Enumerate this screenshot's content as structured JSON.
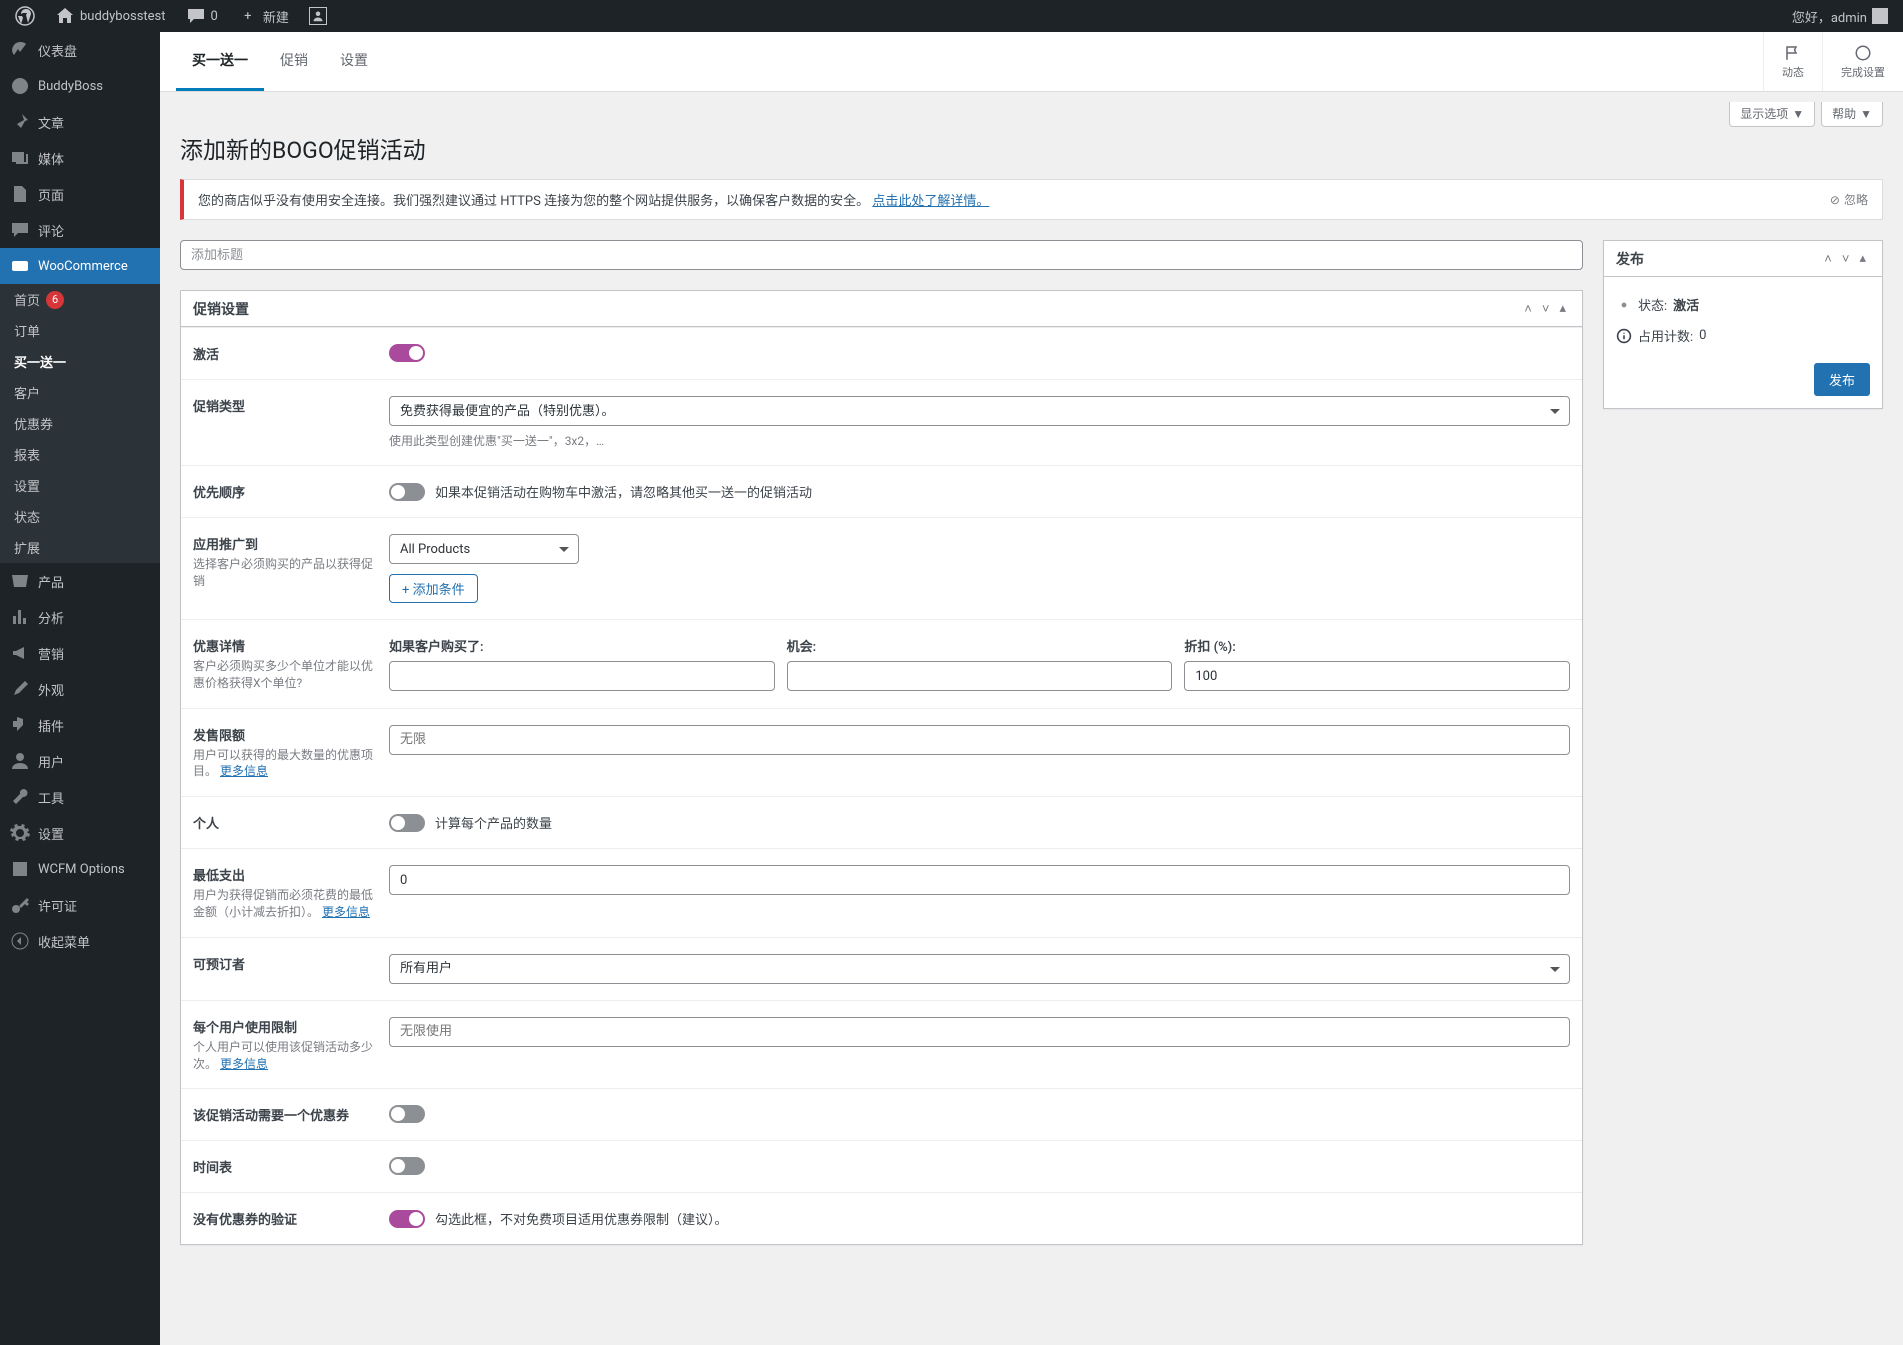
{
  "adminbar": {
    "site_name": "buddybosstest",
    "comments_count": "0",
    "new_label": "新建",
    "greeting": "您好，admin"
  },
  "sidebar": {
    "items": [
      {
        "icon": "dashboard",
        "label": "仪表盘"
      },
      {
        "icon": "buddyboss",
        "label": "BuddyBoss"
      },
      {
        "icon": "post",
        "label": "文章"
      },
      {
        "icon": "media",
        "label": "媒体"
      },
      {
        "icon": "page",
        "label": "页面"
      },
      {
        "icon": "comment",
        "label": "评论"
      },
      {
        "icon": "woo",
        "label": "WooCommerce",
        "current": true
      },
      {
        "icon": "product",
        "label": "产品"
      },
      {
        "icon": "analytics",
        "label": "分析"
      },
      {
        "icon": "marketing",
        "label": "营销"
      },
      {
        "icon": "appearance",
        "label": "外观"
      },
      {
        "icon": "plugin",
        "label": "插件"
      },
      {
        "icon": "user",
        "label": "用户"
      },
      {
        "icon": "tool",
        "label": "工具"
      },
      {
        "icon": "settings",
        "label": "设置"
      },
      {
        "icon": "wcfm",
        "label": "WCFM Options"
      },
      {
        "icon": "license",
        "label": "许可证"
      },
      {
        "icon": "collapse",
        "label": "收起菜单"
      }
    ],
    "woo_submenu": [
      {
        "label": "首页",
        "badge": "6"
      },
      {
        "label": "订单"
      },
      {
        "label": "买一送一",
        "current": true
      },
      {
        "label": "客户"
      },
      {
        "label": "优惠券"
      },
      {
        "label": "报表"
      },
      {
        "label": "设置"
      },
      {
        "label": "状态"
      },
      {
        "label": "扩展"
      }
    ]
  },
  "tabs": {
    "items": [
      {
        "label": "买一送一",
        "active": true
      },
      {
        "label": "促销"
      },
      {
        "label": "设置"
      }
    ],
    "actions": [
      {
        "icon": "flag",
        "label": "动态"
      },
      {
        "icon": "circle",
        "label": "完成设置"
      }
    ]
  },
  "screen_meta": {
    "options": "显示选项",
    "help": "帮助"
  },
  "page_title": "添加新的BOGO促销活动",
  "notice": {
    "text": "您的商店似乎没有使用安全连接。我们强烈建议通过 HTTPS 连接为您的整个网站提供服务，以确保客户数据的安全。",
    "link": "点击此处了解详情。",
    "dismiss": "忽略"
  },
  "title_input": {
    "placeholder": "添加标题"
  },
  "settings_box": {
    "title": "促销设置",
    "rows": {
      "activate": {
        "label": "激活",
        "on": true
      },
      "promo_type": {
        "label": "促销类型",
        "value": "免费获得最便宜的产品（特别优惠）。",
        "help": "使用此类型创建优惠\"买一送一\"，3x2，…"
      },
      "priority": {
        "label": "优先顺序",
        "text": "如果本促销活动在购物车中激活，请忽略其他买一送一的促销活动",
        "on": false
      },
      "apply_to": {
        "label": "应用推广到",
        "help": "选择客户必须购买的产品以获得促销",
        "value": "All Products",
        "button": "+ 添加条件"
      },
      "details": {
        "label": "优惠详情",
        "help": "客户必须购买多少个单位才能以优惠价格获得X个单位?",
        "col1": "如果客户购买了:",
        "col2": "机会:",
        "col3": "折扣 (%):",
        "discount": "100"
      },
      "sale_limit": {
        "label": "发售限额",
        "help": "用户可以获得的最大数量的优惠项目。",
        "more": "更多信息",
        "placeholder": "无限"
      },
      "individual": {
        "label": "个人",
        "text": "计算每个产品的数量",
        "on": false
      },
      "min_spend": {
        "label": "最低支出",
        "help": "用户为获得促销而必须花费的最低金额（小计减去折扣）。",
        "more": "更多信息",
        "value": "0"
      },
      "allowed_users": {
        "label": "可预订者",
        "value": "所有用户"
      },
      "per_user_limit": {
        "label": "每个用户使用限制",
        "help": "个人用户可以使用该促销活动多少次。",
        "more": "更多信息",
        "placeholder": "无限使用"
      },
      "requires_coupon": {
        "label": "该促销活动需要一个优惠券",
        "on": false
      },
      "schedule": {
        "label": "时间表",
        "on": false
      },
      "no_coupon_verify": {
        "label": "没有优惠券的验证",
        "text": "勾选此框，不对免费项目适用优惠券限制（建议）。",
        "on": true
      }
    }
  },
  "publish_box": {
    "title": "发布",
    "status_label": "状态:",
    "status_value": "激活",
    "count_label": "占用计数:",
    "count_value": "0",
    "button": "发布"
  }
}
